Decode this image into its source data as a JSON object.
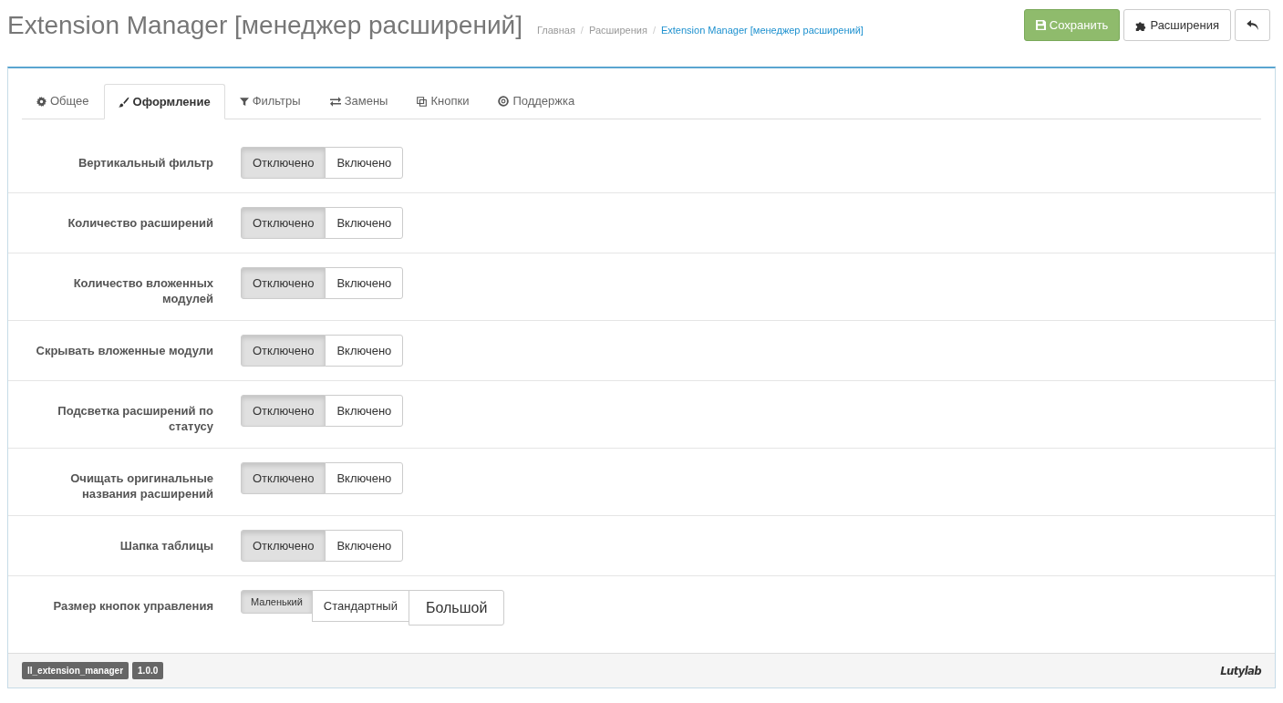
{
  "page_title": "Extension Manager [менеджер расширений]",
  "breadcrumbs": [
    {
      "label": "Главная",
      "current": false
    },
    {
      "label": "Расширения",
      "current": false
    },
    {
      "label": "Extension Manager [менеджер расширений]",
      "current": true
    }
  ],
  "breadcrumb_separator": "/",
  "header_buttons": [
    {
      "kind": "save",
      "label": "Сохранить"
    },
    {
      "kind": "extensions",
      "label": "Расширения"
    },
    {
      "kind": "back"
    }
  ],
  "tabs": [
    {
      "label": "Общее",
      "selected": false
    },
    {
      "label": "Оформление",
      "selected": true
    },
    {
      "label": "Фильтры",
      "selected": false
    },
    {
      "label": "Замены",
      "selected": false
    },
    {
      "label": "Кнопки",
      "selected": false
    },
    {
      "label": "Поддержка",
      "selected": false
    }
  ],
  "settings": [
    {
      "label": "Вертикальный фильтр",
      "options": [
        {
          "label": "Отключено",
          "selected": true
        },
        {
          "label": "Включено",
          "selected": false
        }
      ]
    },
    {
      "label": "Количество расширений",
      "options": [
        {
          "label": "Отключено",
          "selected": true
        },
        {
          "label": "Включено",
          "selected": false
        }
      ]
    },
    {
      "label": "Количество вложенных модулей",
      "options": [
        {
          "label": "Отключено",
          "selected": true
        },
        {
          "label": "Включено",
          "selected": false
        }
      ]
    },
    {
      "label": "Скрывать вложенные модули",
      "options": [
        {
          "label": "Отключено",
          "selected": true
        },
        {
          "label": "Включено",
          "selected": false
        }
      ]
    },
    {
      "label": "Подсветка расширений по статусу",
      "options": [
        {
          "label": "Отключено",
          "selected": true
        },
        {
          "label": "Включено",
          "selected": false
        }
      ]
    },
    {
      "label": "Очищать оригинальные названия расширений",
      "options": [
        {
          "label": "Отключено",
          "selected": true
        },
        {
          "label": "Включено",
          "selected": false
        }
      ]
    },
    {
      "label": "Шапка таблицы",
      "options": [
        {
          "label": "Отключено",
          "selected": true
        },
        {
          "label": "Включено",
          "selected": false
        }
      ]
    },
    {
      "label": "Размер кнопок управления",
      "options": [
        {
          "label": "Маленький",
          "selected": true,
          "kind": "small"
        },
        {
          "label": "Стандартный",
          "selected": false,
          "kind": "normal"
        },
        {
          "label": "Большой",
          "selected": false,
          "kind": "large"
        }
      ]
    }
  ],
  "footer": {
    "badges": [
      "ll_extension_manager",
      "1.0.0"
    ],
    "logo": "Lutylab"
  }
}
